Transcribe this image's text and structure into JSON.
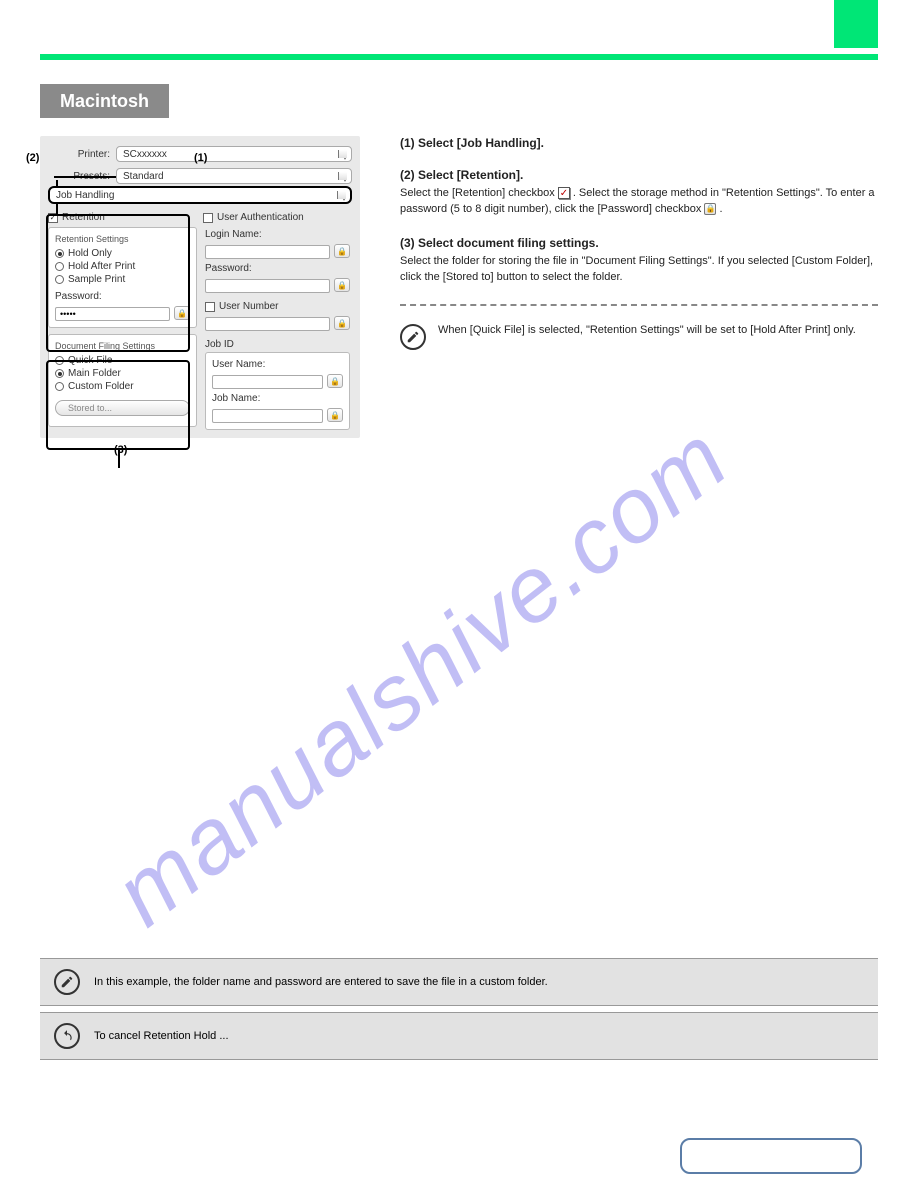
{
  "header": {
    "badge": "Macintosh"
  },
  "dialog": {
    "printer_label": "Printer:",
    "printer_value": "SCxxxxxx",
    "presets_label": "Presets:",
    "presets_value": "Standard",
    "menu_value": "Job Handling",
    "retention": {
      "title": "Retention",
      "settings_label": "Retention Settings",
      "opt1": "Hold Only",
      "opt2": "Hold After Print",
      "opt3": "Sample Print",
      "password_label": "Password:",
      "password_value": "•••••"
    },
    "docfile": {
      "title": "Document Filing Settings",
      "opt1": "Quick File",
      "opt2": "Main Folder",
      "opt3": "Custom Folder",
      "stored_btn": "Stored to..."
    },
    "userauth": {
      "title": "User Authentication",
      "login": "Login Name:",
      "password": "Password:",
      "usernum_title": "User Number",
      "usernum_label": "User Number:"
    },
    "jobid": {
      "title": "Job ID",
      "username": "User Name:",
      "jobname": "Job Name:"
    }
  },
  "markers": {
    "p1": "(1)",
    "p2": "(2)",
    "p3": "(3)"
  },
  "steps": {
    "s1": {
      "title": "(1) Select [Job Handling]."
    },
    "s2": {
      "title": "(2) Select [Retention].",
      "body1": "Select the [Retention] checkbox    . Select the storage method in \"Retention Settings\". To enter a password (5 to 8 digit number), click the [Password] checkbox    .",
      "chk_img": "✓"
    },
    "s3": {
      "title": "(3) Select document filing settings.",
      "body": "Select the folder for storing the file in \"Document Filing Settings\". If you selected [Custom Folder], click the [Stored to] button to select the folder."
    },
    "note": "When [Quick File] is selected, \"Retention Settings\" will be set to [Hold After Print] only."
  },
  "footer": {
    "note1": "In this example, the folder name and password are entered to save the file in a custom folder.",
    "note2": "To cancel Retention Hold ..."
  },
  "watermark": "manualshive.com"
}
